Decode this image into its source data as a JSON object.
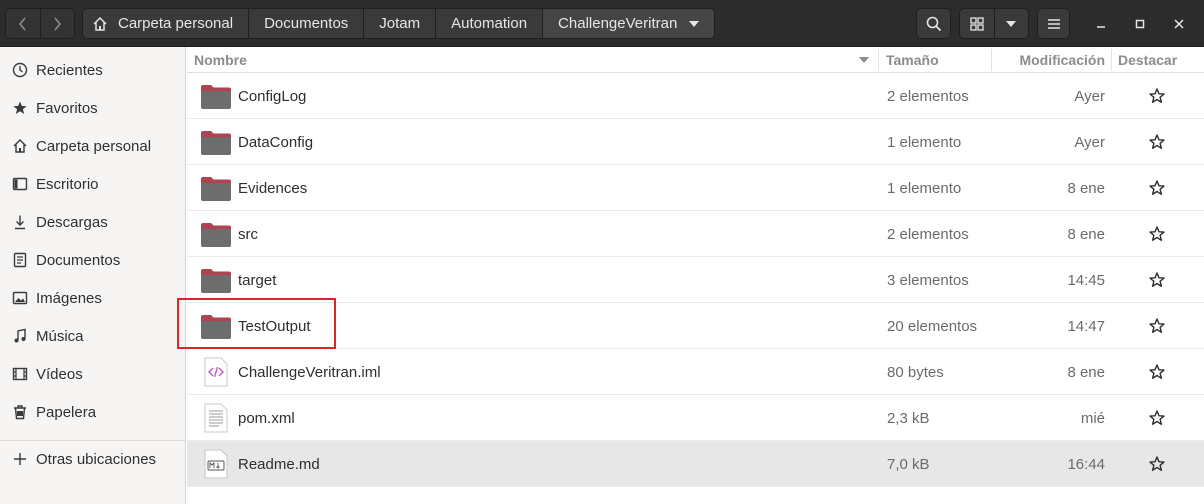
{
  "headerbar": {
    "nav": {
      "back_icon": "chevron-left-icon",
      "forward_icon": "chevron-right-icon"
    },
    "breadcrumbs": [
      "Carpeta personal",
      "Documentos",
      "Jotam",
      "Automation",
      "ChallengeVeritran"
    ],
    "icons": [
      "home-icon",
      "search-icon",
      "grid-view-icon",
      "chevron-down-icon",
      "hamburger-menu-icon",
      "minimize-icon",
      "maximize-icon",
      "close-icon"
    ]
  },
  "sidebar": {
    "items": [
      {
        "label": "Recientes",
        "icon": "clock-icon"
      },
      {
        "label": "Favoritos",
        "icon": "star-filled-icon"
      },
      {
        "label": "Carpeta personal",
        "icon": "home-icon"
      },
      {
        "label": "Escritorio",
        "icon": "desktop-icon"
      },
      {
        "label": "Descargas",
        "icon": "download-icon"
      },
      {
        "label": "Documentos",
        "icon": "document-icon"
      },
      {
        "label": "Imágenes",
        "icon": "image-icon"
      },
      {
        "label": "Música",
        "icon": "music-icon"
      },
      {
        "label": "Vídeos",
        "icon": "video-icon"
      },
      {
        "label": "Papelera",
        "icon": "trash-icon"
      }
    ],
    "other_locations": {
      "label": "Otras ubicaciones",
      "icon": "plus-icon"
    }
  },
  "columns": {
    "name": "Nombre",
    "size": "Tamaño",
    "modified": "Modificación",
    "star": "Destacar"
  },
  "files": [
    {
      "name": "ConfigLog",
      "size": "2 elementos",
      "modified": "Ayer",
      "type": "folder"
    },
    {
      "name": "DataConfig",
      "size": "1 elemento",
      "modified": "Ayer",
      "type": "folder"
    },
    {
      "name": "Evidences",
      "size": "1 elemento",
      "modified": "8 ene",
      "type": "folder"
    },
    {
      "name": "src",
      "size": "2 elementos",
      "modified": "8 ene",
      "type": "folder"
    },
    {
      "name": "target",
      "size": "3 elementos",
      "modified": "14:45",
      "type": "folder"
    },
    {
      "name": "TestOutput",
      "size": "20 elementos",
      "modified": "14:47",
      "type": "folder"
    },
    {
      "name": "ChallengeVeritran.iml",
      "size": "80 bytes",
      "modified": "8 ene",
      "type": "xml-file"
    },
    {
      "name": "pom.xml",
      "size": "2,3 kB",
      "modified": "mié",
      "type": "text-file"
    },
    {
      "name": "Readme.md",
      "size": "7,0 kB",
      "modified": "16:44",
      "type": "markdown-file"
    }
  ],
  "colors": {
    "headerbar": "#2c2c2c",
    "folder": "#6d6d6d",
    "folder_tab": "#b0434f",
    "highlight": "#d9262a",
    "selected_row": "#e7e7e7"
  }
}
